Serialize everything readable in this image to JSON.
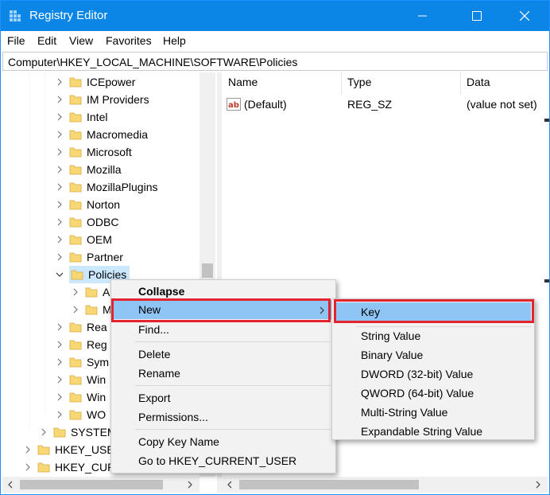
{
  "window": {
    "title": "Registry Editor",
    "accent": "#0b86e6"
  },
  "menubar": {
    "items": [
      "File",
      "Edit",
      "View",
      "Favorites",
      "Help"
    ]
  },
  "address": {
    "path": "Computer\\HKEY_LOCAL_MACHINE\\SOFTWARE\\Policies"
  },
  "tree": {
    "items": [
      {
        "label": "ICEpower",
        "state": "collapsed"
      },
      {
        "label": "IM Providers",
        "state": "collapsed"
      },
      {
        "label": "Intel",
        "state": "collapsed"
      },
      {
        "label": "Macromedia",
        "state": "collapsed"
      },
      {
        "label": "Microsoft",
        "state": "collapsed"
      },
      {
        "label": "Mozilla",
        "state": "collapsed"
      },
      {
        "label": "MozillaPlugins",
        "state": "collapsed"
      },
      {
        "label": "Norton",
        "state": "collapsed"
      },
      {
        "label": "ODBC",
        "state": "collapsed"
      },
      {
        "label": "OEM",
        "state": "collapsed"
      },
      {
        "label": "Partner",
        "state": "collapsed"
      },
      {
        "label": "Policies",
        "state": "expanded",
        "selected": true
      },
      {
        "label": "A",
        "state": "collapsed",
        "child": true
      },
      {
        "label": "M",
        "state": "collapsed",
        "child": true
      },
      {
        "label": "Rea",
        "state": "collapsed"
      },
      {
        "label": "Reg",
        "state": "collapsed"
      },
      {
        "label": "Sym",
        "state": "collapsed"
      },
      {
        "label": "Win",
        "state": "collapsed"
      },
      {
        "label": "Win",
        "state": "collapsed"
      },
      {
        "label": "WO",
        "state": "collapsed"
      },
      {
        "label": "SYSTEM",
        "state": "collapsed",
        "level": 1
      },
      {
        "label": "HKEY_USE",
        "state": "collapsed",
        "level": 0
      },
      {
        "label": "HKEY_CUR",
        "state": "collapsed",
        "level": 0
      }
    ]
  },
  "list": {
    "columns": [
      "Name",
      "Type",
      "Data"
    ],
    "rows": [
      {
        "name": "(Default)",
        "type": "REG_SZ",
        "data": "(value not set)"
      }
    ]
  },
  "context_menu": {
    "items": [
      {
        "label": "Collapse",
        "bold": true
      },
      {
        "label": "New",
        "submenu": true,
        "highlighted": true
      },
      {
        "label": "Find..."
      },
      {
        "label": "Delete"
      },
      {
        "label": "Rename"
      },
      {
        "label": "Export"
      },
      {
        "label": "Permissions..."
      },
      {
        "label": "Copy Key Name"
      },
      {
        "label": "Go to HKEY_CURRENT_USER"
      }
    ],
    "highlight_color": "#8ec5f5",
    "callout_color": "#e3232d"
  },
  "submenu": {
    "items": [
      {
        "label": "Key",
        "highlighted": true
      },
      {
        "label": "String Value"
      },
      {
        "label": "Binary Value"
      },
      {
        "label": "DWORD (32-bit) Value"
      },
      {
        "label": "QWORD (64-bit) Value"
      },
      {
        "label": "Multi-String Value"
      },
      {
        "label": "Expandable String Value"
      }
    ]
  }
}
